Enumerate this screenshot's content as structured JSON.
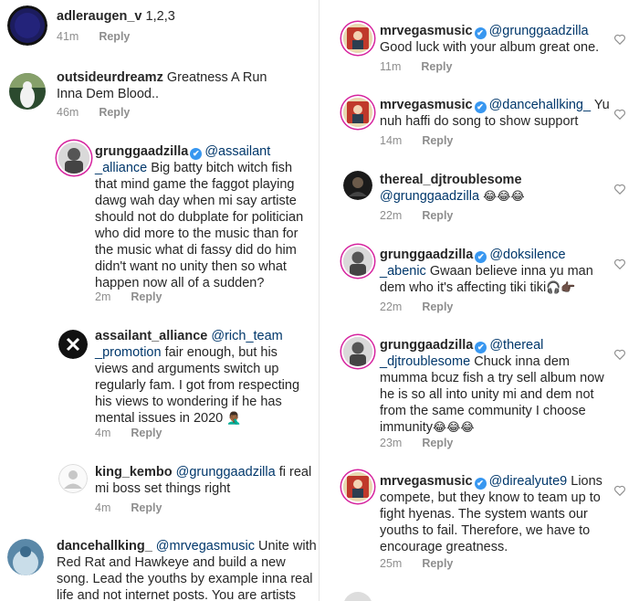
{
  "left": [
    {
      "username": "adleraugen_v",
      "text": "1,2,3",
      "time": "41m",
      "reply": "Reply"
    },
    {
      "username": "outsideurdreamz",
      "text": "Greatness A Run Inna Dem Blood..",
      "time": "46m",
      "reply": "Reply"
    },
    {
      "username": "grunggaadzilla",
      "mention_a": "@assailant",
      "mention_b": "_alliance",
      "text": "Big batty bitch witch fish that mind game the faggot playing dawg wah day when mi say artiste should not do dubplate for politician who did more to the music than for the music what di fassy did do him didn't want no unity then so what happen now all of a sudden?",
      "time": "2m",
      "reply": "Reply"
    },
    {
      "username": "assailant_alliance",
      "mention_a": "@rich_team",
      "mention_b": "_promotion",
      "text": "fair enough, but his views and arguments switch up regularly fam. I got from respecting his views to wondering if he has mental issues in 2020",
      "emoji": "🤦🏾‍♂️",
      "time": "4m",
      "reply": "Reply"
    },
    {
      "username": "king_kembo",
      "mention": "@grunggaadzilla",
      "text": "fi real mi boss set things right",
      "time": "4m",
      "reply": "Reply"
    },
    {
      "username": "dancehallking_",
      "mention": "@mrvegasmusic",
      "text": "Unite with Red Rat and Hawkeye and build a new song. Lead the youths by example inna real life and not internet posts. You are artists are"
    }
  ],
  "right": [
    {
      "username": "mrvegasmusic",
      "mention": "@grunggaadzilla",
      "text": "Good luck with your album great one.",
      "time": "11m",
      "reply": "Reply"
    },
    {
      "username": "mrvegasmusic",
      "mention": "@dancehallking_",
      "text": "Yu nuh haffi do song to show support",
      "time": "14m",
      "reply": "Reply"
    },
    {
      "username": "thereal_djtroublesome",
      "mention": "@grunggaadzilla",
      "emoji": "😂😂😂",
      "time": "22m",
      "reply": "Reply"
    },
    {
      "username": "grunggaadzilla",
      "mention_a": "@doksilence",
      "mention_b": "_abenic",
      "text": "Gwaan believe inna yu man dem who it's affecting tiki tiki",
      "emoji": "🎧👉🏿",
      "time": "22m",
      "reply": "Reply"
    },
    {
      "username": "grunggaadzilla",
      "mention_a": "@thereal",
      "mention_b": "_djtroublesome",
      "text": "Chuck inna dem mumma bcuz fish a try sell album now he is so all into unity mi and dem not from the same community I choose immunity",
      "emoji": "😂😂😂",
      "time": "23m",
      "reply": "Reply"
    },
    {
      "username": "mrvegasmusic",
      "mention": "@direalyute9",
      "text": "Lions compete, but they know to team up to fight hyenas. The system wants our youths to fail. Therefore, we have to encourage greatness.",
      "time": "25m",
      "reply": "Reply"
    }
  ],
  "verified_check": "✔",
  "colors": {
    "mention": "#00376b",
    "meta": "#8e8e8e",
    "verified": "#3897f0"
  }
}
